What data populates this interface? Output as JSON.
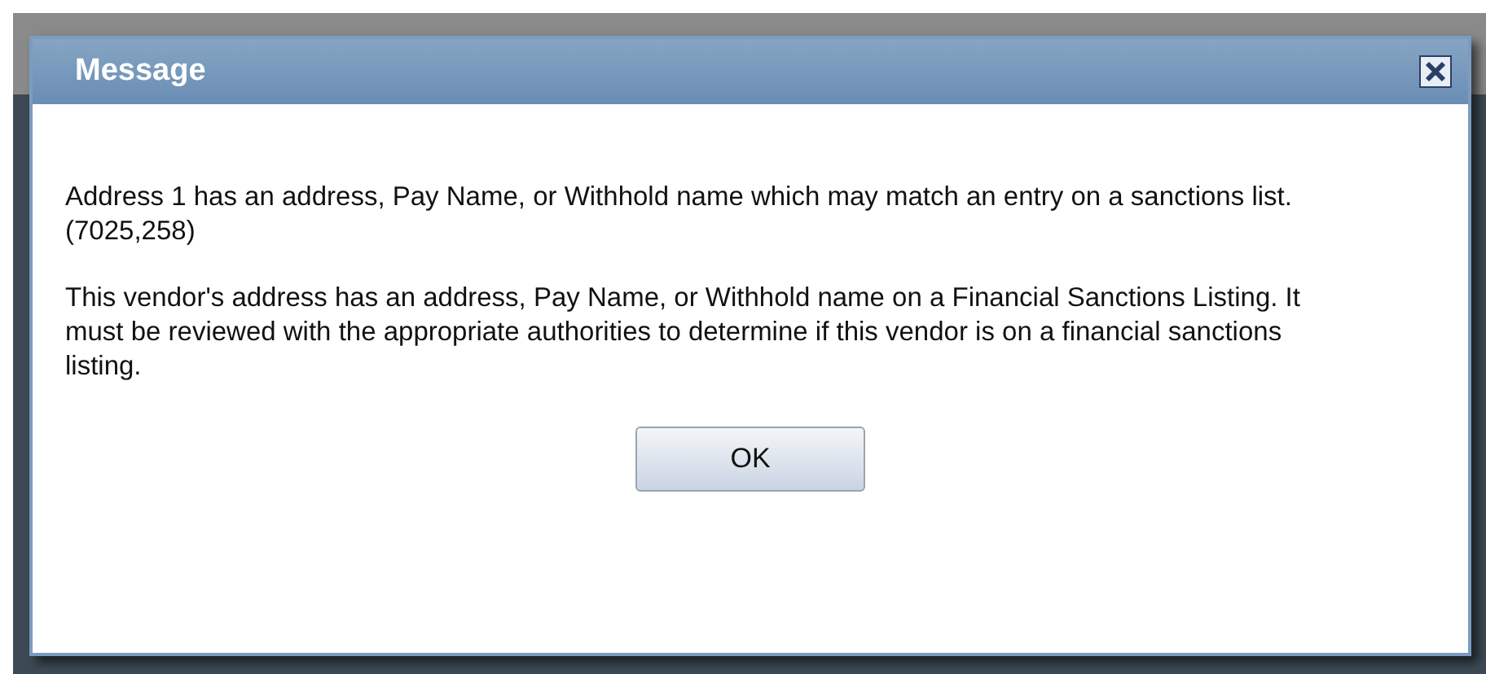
{
  "dialog": {
    "title": "Message",
    "paragraphs": [
      "Address 1 has an address, Pay Name, or Withhold name which may match an entry on a sanctions list. (7025,258)",
      "This vendor's address has an address, Pay Name, or Withhold name on a Financial Sanctions Listing.  It must be reviewed with the appropriate authorities to determine if this vendor is on a financial sanctions listing."
    ],
    "buttons": [
      "OK"
    ]
  }
}
